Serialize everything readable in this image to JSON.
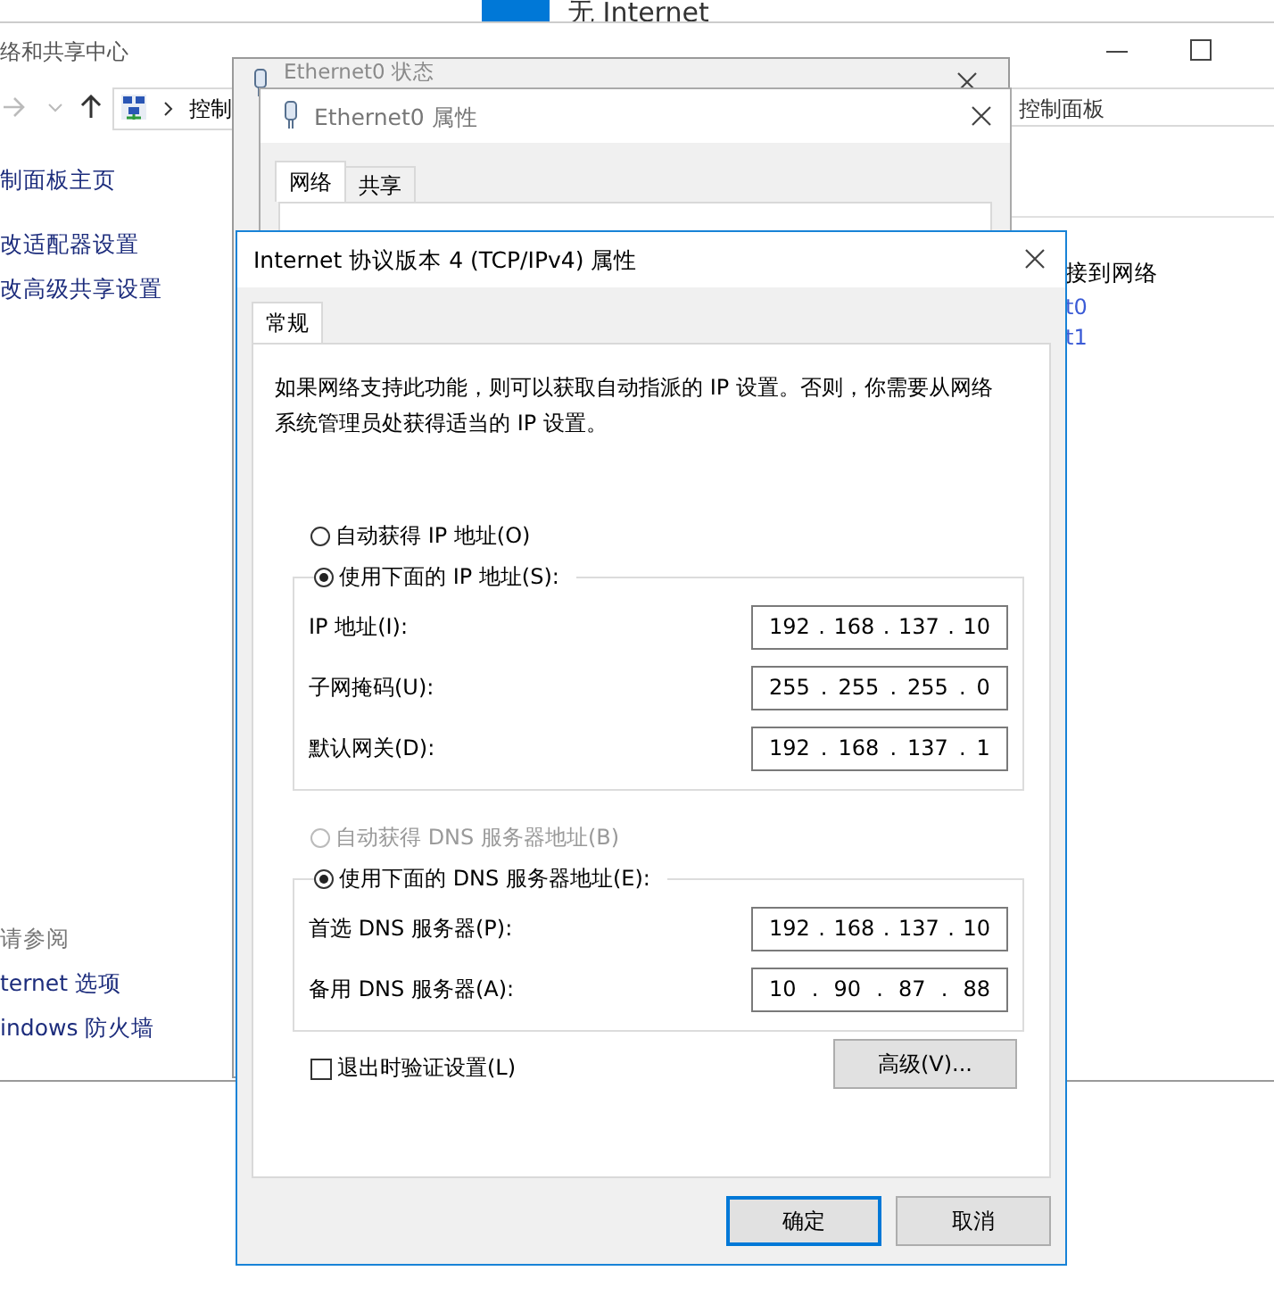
{
  "top_fragment": {
    "label": "无 Internet"
  },
  "background_window": {
    "title": "络和共享中心",
    "address_path": "控制",
    "search_placeholder": "控制面板",
    "sidebar_links": [
      "制面板主页",
      "改适配器设置",
      "改高级共享设置"
    ],
    "see_also": {
      "heading": "请参阅",
      "links": [
        "ternet 选项",
        "indows 防火墙"
      ]
    },
    "right_heading": "接到网络",
    "right_links": [
      "t0",
      "t1"
    ]
  },
  "status_window": {
    "title": "Ethernet0 状态"
  },
  "properties_window": {
    "title": "Ethernet0 属性",
    "tabs": [
      {
        "label": "网络",
        "selected": true
      },
      {
        "label": "共享",
        "selected": false
      }
    ]
  },
  "dialog": {
    "title": "Internet 协议版本 4 (TCP/IPv4) 属性",
    "tabs": [
      {
        "label": "常规",
        "selected": true
      }
    ],
    "description": "如果网络支持此功能，则可以获取自动指派的 IP 设置。否则，你需要从网络系统管理员处获得适当的 IP 设置。",
    "ip_options": [
      {
        "label": "自动获得 IP 地址(O)",
        "selected": false,
        "disabled": false
      },
      {
        "label": "使用下面的 IP 地址(S):",
        "selected": true,
        "disabled": false
      }
    ],
    "ip_fields": [
      {
        "label": "IP 地址(I):",
        "value": "192 . 168 . 137 . 10"
      },
      {
        "label": "子网掩码(U):",
        "value": "255 . 255 . 255 . 0"
      },
      {
        "label": "默认网关(D):",
        "value": "192 . 168 . 137 . 1"
      }
    ],
    "dns_options": [
      {
        "label": "自动获得 DNS 服务器地址(B)",
        "selected": false,
        "disabled": true
      },
      {
        "label": "使用下面的 DNS 服务器地址(E):",
        "selected": true,
        "disabled": false
      }
    ],
    "dns_fields": [
      {
        "label": "首选 DNS 服务器(P):",
        "value": "192 . 168 . 137 . 10"
      },
      {
        "label": "备用 DNS 服务器(A):",
        "value": "10 . 90 . 87 . 88"
      }
    ],
    "verify_checkbox": {
      "label": "退出时验证设置(L)",
      "checked": false
    },
    "advanced_button": "高级(V)...",
    "buttons": [
      {
        "label": "确定",
        "default": true
      },
      {
        "label": "取消",
        "default": false
      }
    ]
  }
}
